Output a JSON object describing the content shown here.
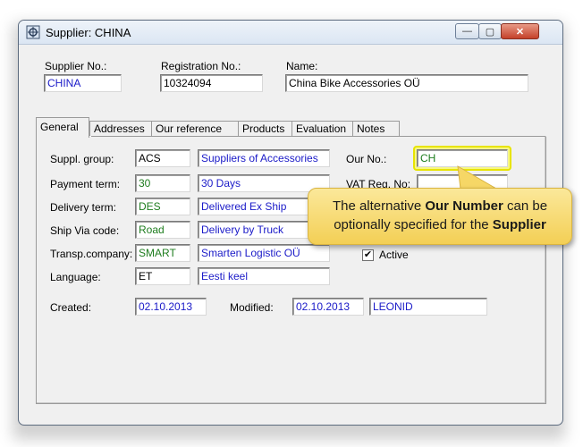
{
  "window": {
    "title": "Supplier: CHINA",
    "controls": {
      "minimize": "—",
      "maximize": "▢",
      "close": "✕"
    }
  },
  "header": {
    "supplier_no_label": "Supplier No.:",
    "supplier_no_value": "CHINA",
    "registration_no_label": "Registration No.:",
    "registration_no_value": "10324094",
    "name_label": "Name:",
    "name_value": "China Bike Accessories OÜ"
  },
  "tabs": [
    "General",
    "Addresses",
    "Our reference",
    "Products",
    "Evaluation",
    "Notes"
  ],
  "active_tab": "General",
  "general": {
    "suppl_group_label": "Suppl. group:",
    "suppl_group_code": "ACS",
    "suppl_group_name": "Suppliers of Accessories",
    "payment_term_label": "Payment term:",
    "payment_term_code": "30",
    "payment_term_name": "30 Days",
    "delivery_term_label": "Delivery term:",
    "delivery_term_code": "DES",
    "delivery_term_name": "Delivered Ex Ship",
    "ship_via_label": "Ship Via code:",
    "ship_via_code": "Road",
    "ship_via_name": "Delivery by Truck",
    "transp_company_label": "Transp.company:",
    "transp_company_code": "SMART",
    "transp_company_name": "Smarten Logistic OÜ",
    "language_label": "Language:",
    "language_code": "ET",
    "language_name": "Eesti keel",
    "our_no_label": "Our No.:",
    "our_no_value": "CH",
    "vat_reg_label": "VAT Reg. No:",
    "vat_reg_value": "",
    "active_label": "Active",
    "active_checked": true,
    "active_mark": "✔",
    "created_label": "Created:",
    "created_value": "02.10.2013",
    "modified_label": "Modified:",
    "modified_value": "02.10.2013",
    "modified_by": "LEONID"
  },
  "callout": {
    "line1_pre": "The alternative ",
    "line1_bold": "Our Number",
    "line1_post": " can be",
    "line2_pre": "optionally specified for the ",
    "line2_bold": "Supplier"
  },
  "colors": {
    "code_green": "#1e7d1e",
    "value_blue": "#1a1ac8",
    "callout_bg": "#f3cf55",
    "highlight": "#e8e400"
  },
  "icons": {
    "app": "supplier-app-icon"
  }
}
